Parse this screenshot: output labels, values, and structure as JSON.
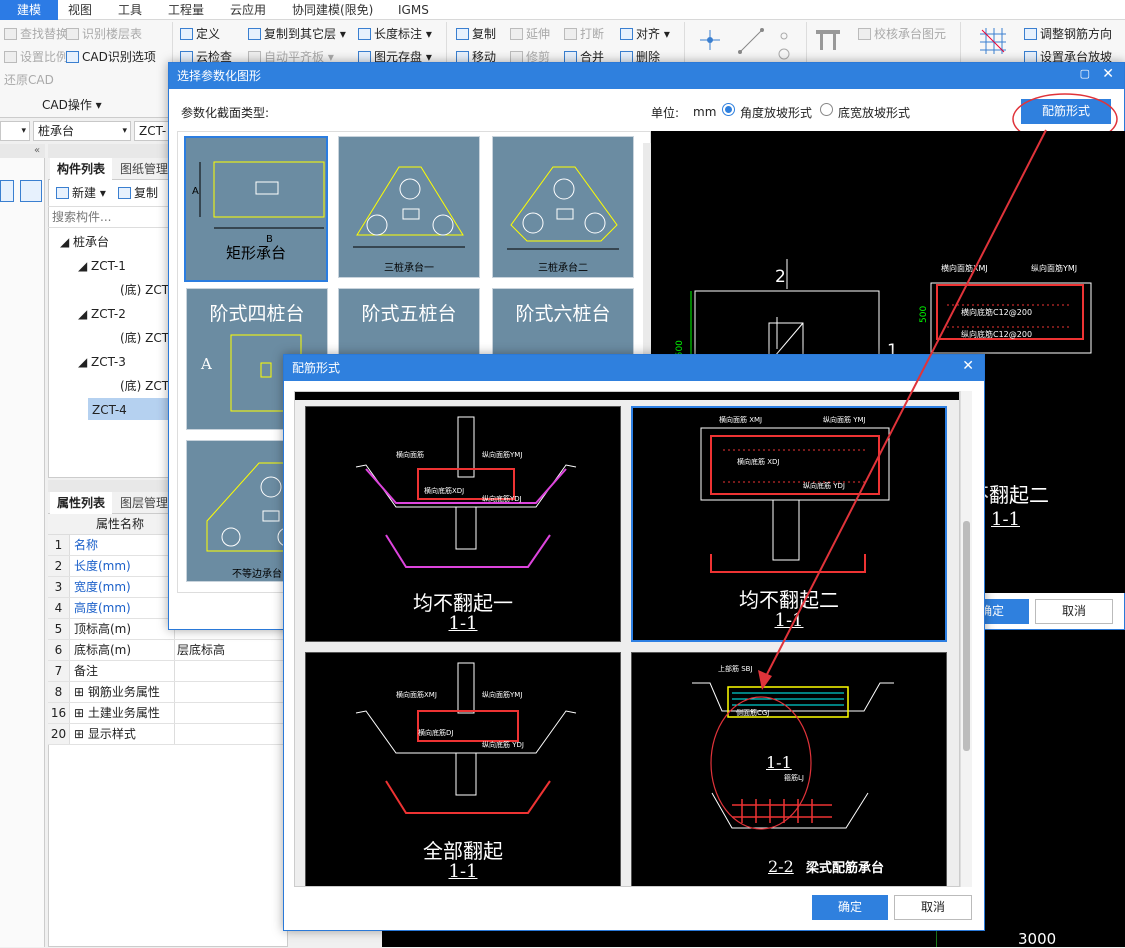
{
  "menu": {
    "items": [
      "建模",
      "视图",
      "工具",
      "工程量",
      "云应用",
      "协同建模(限免)",
      "IGMS"
    ]
  },
  "ribbon": {
    "group1": {
      "items": [
        "查找替换",
        "设置比例",
        "还原CAD"
      ],
      "items2": [
        "识别楼层表",
        "CAD识别选项"
      ],
      "label": "CAD操作"
    },
    "group2": {
      "items": [
        "定义",
        "云检查"
      ],
      "items2": [
        "复制到其它层",
        "自动平齐板"
      ],
      "items3": [
        "长度标注",
        "图元存盘"
      ]
    },
    "group3": {
      "items": [
        "复制",
        "移动"
      ],
      "items2": [
        "延伸",
        "修剪"
      ],
      "items3": [
        "打断",
        "合并"
      ],
      "items4": [
        "对齐",
        "删除"
      ]
    },
    "group4": {
      "items": [
        "校核承台图元"
      ]
    },
    "group5": {
      "items": [
        "调整钢筋方向",
        "设置承台放坡"
      ]
    }
  },
  "toolbar": {
    "combo1": "",
    "combo2": "桩承台",
    "combo3": "ZCT-4"
  },
  "component_panel": {
    "tabs": [
      "构件列表",
      "图纸管理"
    ],
    "new_label": "新建",
    "copy_label": "复制",
    "search_placeholder": "搜索构件...",
    "tree": [
      {
        "label": "桩承台",
        "level": 0
      },
      {
        "label": "ZCT-1",
        "level": 1
      },
      {
        "label": "(底) ZCT",
        "level": 2
      },
      {
        "label": "ZCT-2",
        "level": 1
      },
      {
        "label": "(底) ZCT",
        "level": 2
      },
      {
        "label": "ZCT-3",
        "level": 1
      },
      {
        "label": "(底) ZCT",
        "level": 2
      },
      {
        "label": "ZCT-4",
        "level": 1,
        "selected": true
      }
    ]
  },
  "property_panel": {
    "tabs": [
      "属性列表",
      "图层管理"
    ],
    "header": "属性名称",
    "rows": [
      {
        "num": "1",
        "name": "名称",
        "value": "",
        "blue": true
      },
      {
        "num": "2",
        "name": "长度(mm)",
        "value": "",
        "blue": true
      },
      {
        "num": "3",
        "name": "宽度(mm)",
        "value": "",
        "blue": true
      },
      {
        "num": "4",
        "name": "高度(mm)",
        "value": "",
        "blue": true
      },
      {
        "num": "5",
        "name": "顶标高(m)",
        "value": ""
      },
      {
        "num": "6",
        "name": "底标高(m)",
        "value": "层底标高"
      },
      {
        "num": "7",
        "name": "备注",
        "value": ""
      },
      {
        "num": "8",
        "name": "钢筋业务属性",
        "value": "",
        "expand": true
      },
      {
        "num": "16",
        "name": "土建业务属性",
        "value": "",
        "expand": true
      },
      {
        "num": "20",
        "name": "显示样式",
        "value": "",
        "expand": true
      }
    ]
  },
  "dialog_param": {
    "title": "选择参数化图形",
    "section_label": "参数化截面类型:",
    "unit_label": "单位:",
    "unit_value": "mm",
    "radio1": "角度放坡形式",
    "radio2": "底宽放坡形式",
    "rebar_button": "配筋形式",
    "tiles": [
      "矩形承台",
      "三桩承台一",
      "三桩承台二",
      "阶式四桩台",
      "阶式五桩台",
      "阶式六桩台",
      "不等边承台"
    ],
    "preview": {
      "num2": "2",
      "num1": "1",
      "dim": "1500",
      "dim500": "500",
      "caption1": "不翻起二",
      "caption2": "1-1"
    },
    "ok_label": "确定",
    "cancel_label": "取消"
  },
  "dialog_rebar": {
    "title": "配筋形式",
    "items": [
      {
        "caption1": "均不翻起一",
        "caption2": "1-1"
      },
      {
        "caption1": "均不翻起二",
        "caption2": "1-1",
        "selected": true
      },
      {
        "caption1": "全部翻起",
        "caption2": "1-1"
      },
      {
        "caption1": "梁式配筋承台",
        "caption2": "1-1",
        "caption3": "2-2"
      }
    ],
    "labels": {
      "hxmj": "横向面筋XMJ",
      "zxmj": "纵向面筋YMJ",
      "hxdj": "横向底筋XDJ",
      "zxdj": "纵向底筋YDJ"
    },
    "ok_label": "确定",
    "cancel_label": "取消"
  },
  "bottom_dim": "3000",
  "colors": {
    "accent": "#2f80de",
    "tile": "#6b8ca2",
    "annotation": "#e0333a"
  }
}
